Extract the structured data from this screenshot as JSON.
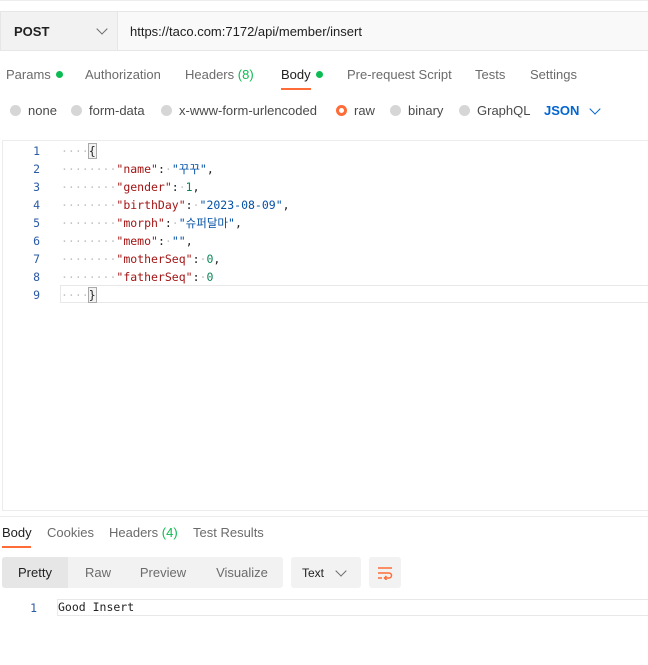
{
  "request": {
    "method": "POST",
    "url": "https://taco.com:7172/api/member/insert"
  },
  "tabs": [
    {
      "label": "Params",
      "dot": true
    },
    {
      "label": "Authorization"
    },
    {
      "label": "Headers",
      "count": "(8)"
    },
    {
      "label": "Body",
      "dot": true,
      "active": true
    },
    {
      "label": "Pre-request Script"
    },
    {
      "label": "Tests"
    },
    {
      "label": "Settings"
    }
  ],
  "body_types": {
    "options": [
      "none",
      "form-data",
      "x-www-form-urlencoded",
      "raw",
      "binary",
      "GraphQL"
    ],
    "selected": "raw",
    "language": "JSON"
  },
  "editor": {
    "line_numbers": [
      "1",
      "2",
      "3",
      "4",
      "5",
      "6",
      "7",
      "8",
      "9"
    ],
    "lines": [
      "{",
      "\"name\": \"꾸꾸\",",
      "\"gender\": 1,",
      "\"birthDay\": \"2023-08-09\",",
      "\"morph\": \"슈퍼달마\",",
      "\"memo\": \"\",",
      "\"motherSeq\": 0,",
      "\"fatherSeq\": 0",
      "}"
    ],
    "body_json": {
      "name": "꾸꾸",
      "gender": "1",
      "birthDay": "2023-08-09",
      "morph": "슈퍼달마",
      "memo": "",
      "motherSeq": "0",
      "fatherSeq": "0"
    }
  },
  "response": {
    "tabs": [
      {
        "label": "Body",
        "active": true
      },
      {
        "label": "Cookies"
      },
      {
        "label": "Headers",
        "count": "(4)"
      },
      {
        "label": "Test Results"
      }
    ],
    "view_modes": [
      "Pretty",
      "Raw",
      "Preview",
      "Visualize"
    ],
    "active_view": "Pretty",
    "format": "Text",
    "line_number": "1",
    "body": "Good Insert"
  },
  "colors": {
    "accent": "#ff6c37",
    "status_dot": "#0cbb52",
    "link_blue": "#0265d2"
  }
}
